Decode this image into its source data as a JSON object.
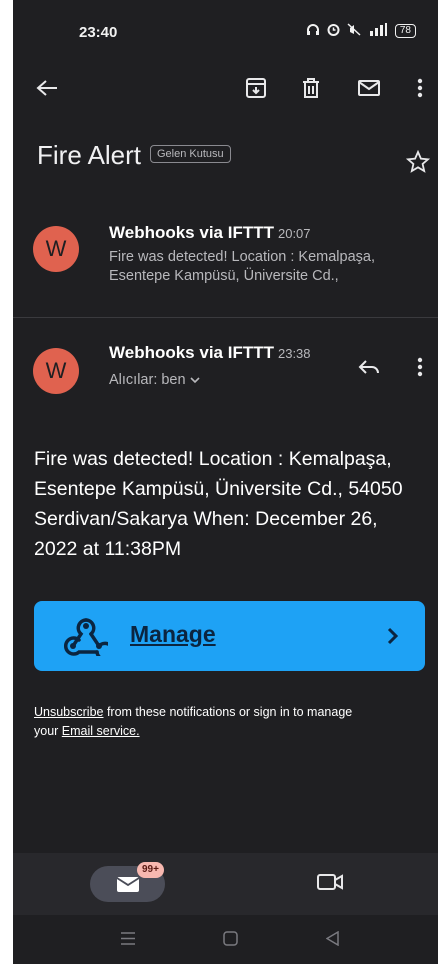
{
  "status_bar": {
    "time": "23:40",
    "battery": "78"
  },
  "email": {
    "subject": "Fire Alert",
    "label_chip": "Gelen Kutusu",
    "first_message": {
      "avatar_letter": "W",
      "sender": "Webhooks via IFTTT",
      "time": "20:07",
      "snippet_line1": "Fire was detected! Location : Kemalpaşa,",
      "snippet_line2": "Esentepe Kampüsü, Üniversite Cd.,"
    },
    "open_message": {
      "avatar_letter": "W",
      "sender": "Webhooks via IFTTT",
      "time": "23:38",
      "recipients": "Alıcılar: ben",
      "body_line1": "Fire was detected! Location : Kemalpaşa,",
      "body_line2": "Esentepe Kampüsü, Üniversite Cd., 54050",
      "body_line3": "Serdivan/Sakarya When: December 26,",
      "body_line4": "2022 at 11:38PM",
      "manage_label": "Manage",
      "footer_unsubscribe": "Unsubscribe",
      "footer_mid": " from these notifications or sign in to manage",
      "footer_your": "your ",
      "footer_email_service": "Email service."
    }
  },
  "bottom_nav": {
    "mail_badge": "99+"
  },
  "colors": {
    "background": "#1f1f22",
    "avatar": "#e0624f",
    "manage_button": "#1ea2f5",
    "badge": "#f7b8b0"
  }
}
